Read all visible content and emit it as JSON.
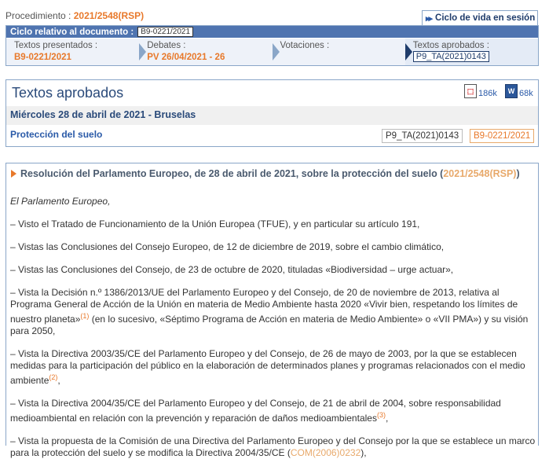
{
  "procedure": {
    "label": "Procedimiento : ",
    "ref": "2021/2548(RSP)"
  },
  "lifecycle_button": "Ciclo de vida en sesión",
  "cycle": {
    "header_label": "Ciclo relativo al documento :",
    "header_doc": "B9-0221/2021",
    "steps": [
      {
        "label": "Textos presentados :",
        "value": "B9-0221/2021"
      },
      {
        "label": "Debates :",
        "value": "PV 26/04/2021 - 26"
      },
      {
        "label": "Votaciones :",
        "value": ""
      },
      {
        "label": "Textos aprobados :",
        "value": "P9_TA(2021)0143"
      }
    ]
  },
  "panel": {
    "title": "Textos aprobados",
    "pdf_size": "186k",
    "word_size": "68k",
    "date_line": "Miércoles 28 de abril de 2021 - Bruselas",
    "subject": "Protección del suelo",
    "ta_ref": "P9_TA(2021)0143",
    "b9_ref": "B9-0221/2021"
  },
  "resolution": {
    "title_main": "Resolución del Parlamento Europeo, de 28 de abril de 2021, sobre la protección del suelo (",
    "title_ref": "2021/2548(RSP)",
    "title_close": ")",
    "intro": "El Parlamento Europeo,",
    "para1": "–  Visto el Tratado de Funcionamiento de la Unión Europea (TFUE), y en particular su artículo 191,",
    "para2": "–  Vistas las Conclusiones del Consejo Europeo, de 12 de diciembre de 2019, sobre el cambio climático,",
    "para3": "–  Vistas las Conclusiones del Consejo, de 23 de octubre de 2020, tituladas «Biodiversidad – urge actuar»,",
    "para4a": "–  Vista la Decisión n.º 1386/2013/UE del Parlamento Europeo y del Consejo, de 20 de noviembre de 2013, relativa al Programa General de Acción de la Unión en materia de Medio Ambiente hasta 2020 «Vivir bien, respetando los límites de nuestro planeta»",
    "para4_note": "(1)",
    "para4b": " (en lo sucesivo, «Séptimo Programa de Acción en materia de Medio Ambiente» o «VII PMA») y su visión para 2050,",
    "para5a": "–  Vista la Directiva 2003/35/CE del Parlamento Europeo y del Consejo, de 26 de mayo de 2003, por la que se establecen medidas para la participación del público en la elaboración de determinados planes y programas relacionados con el medio ambiente",
    "para5_note": "(2)",
    "para5b": ",",
    "para6a": "–  Vista la Directiva 2004/35/CE del Parlamento Europeo y del Consejo, de 21 de abril de 2004, sobre responsabilidad medioambiental en relación con la prevención y reparación de daños medioambientales",
    "para6_note": "(3)",
    "para6b": ",",
    "para7a": "–  Vista la propuesta de la Comisión de una Directiva del Parlamento Europeo y del Consejo por la que se establece un marco para la protección del suelo y se modifica la Directiva 2004/35/CE (",
    "para7_link": "COM(2006)0232",
    "para7b": "),"
  },
  "colors": {
    "accent": "#e8792b",
    "header_blue": "#4f74b0",
    "title_blue": "#2a4a7a",
    "border": "#8aa6c8"
  }
}
